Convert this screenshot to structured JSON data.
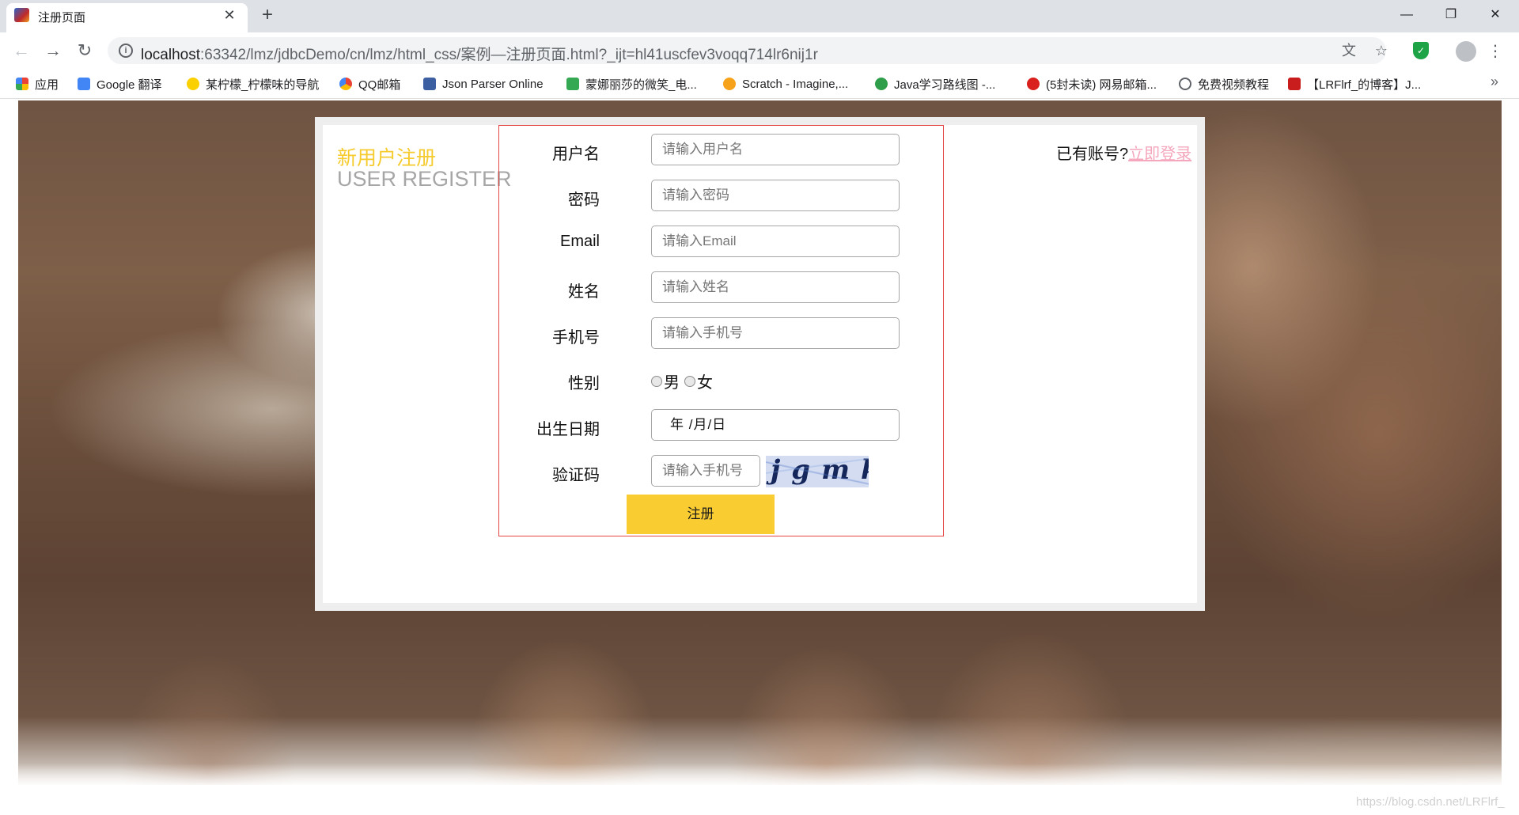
{
  "browser": {
    "tab_title": "注册页面",
    "url_host": "localhost",
    "url_rest": ":63342/lmz/jdbcDemo/cn/lmz/html_css/案例—注册页面.html?_ijt=hl41uscfev3voqq714lr6nij1r",
    "window_controls": {
      "minimize": "—",
      "restore": "❐",
      "close": "✕"
    }
  },
  "bookmarks": [
    {
      "label": "应用",
      "icon": "apps-grid-icon",
      "color": "#ea4335"
    },
    {
      "label": "Google 翻译",
      "icon": "google-translate-icon",
      "color": "#4285f4"
    },
    {
      "label": "某柠檬_柠檬味的导航",
      "icon": "lemon-icon",
      "color": "#fbd000"
    },
    {
      "label": "QQ邮箱",
      "icon": "qq-mail-icon",
      "color": "#f4b400"
    },
    {
      "label": "Json Parser Online",
      "icon": "json-icon",
      "color": "#3b5fa0"
    },
    {
      "label": "蒙娜丽莎的微笑_电...",
      "icon": "play-icon",
      "color": "#34a853"
    },
    {
      "label": "Scratch - Imagine,...",
      "icon": "scratch-icon",
      "color": "#f7a21b"
    },
    {
      "label": "Java学习路线图 -...",
      "icon": "java-icon",
      "color": "#2e9e4a"
    },
    {
      "label": "(5封未读) 网易邮箱...",
      "icon": "netease-mail-icon",
      "color": "#d9201c"
    },
    {
      "label": "免费视频教程",
      "icon": "video-icon",
      "color": "#5f6368"
    },
    {
      "label": "【LRFlrf_的博客】J...",
      "icon": "csdn-icon",
      "color": "#c91c1c"
    }
  ],
  "page": {
    "title_cn": "新用户注册",
    "title_en": "USER REGISTER",
    "login_prompt": "已有账号?",
    "login_link": "立即登录",
    "watermark": "https://blog.csdn.net/LRFlrf_",
    "accent_color": "#f9cd31",
    "form": {
      "username": {
        "label": "用户名",
        "placeholder": "请输入用户名"
      },
      "password": {
        "label": "密码",
        "placeholder": "请输入密码"
      },
      "email": {
        "label": "Email",
        "placeholder": "请输入Email"
      },
      "name": {
        "label": "姓名",
        "placeholder": "请输入姓名"
      },
      "phone": {
        "label": "手机号",
        "placeholder": "请输入手机号"
      },
      "gender": {
        "label": "性别",
        "options": [
          "男",
          "女"
        ]
      },
      "birthday": {
        "label": "出生日期",
        "value": "年 /月/日"
      },
      "captcha": {
        "label": "验证码",
        "placeholder": "请输入手机号",
        "image_text": "jgmkj"
      },
      "submit_label": "注册"
    }
  }
}
